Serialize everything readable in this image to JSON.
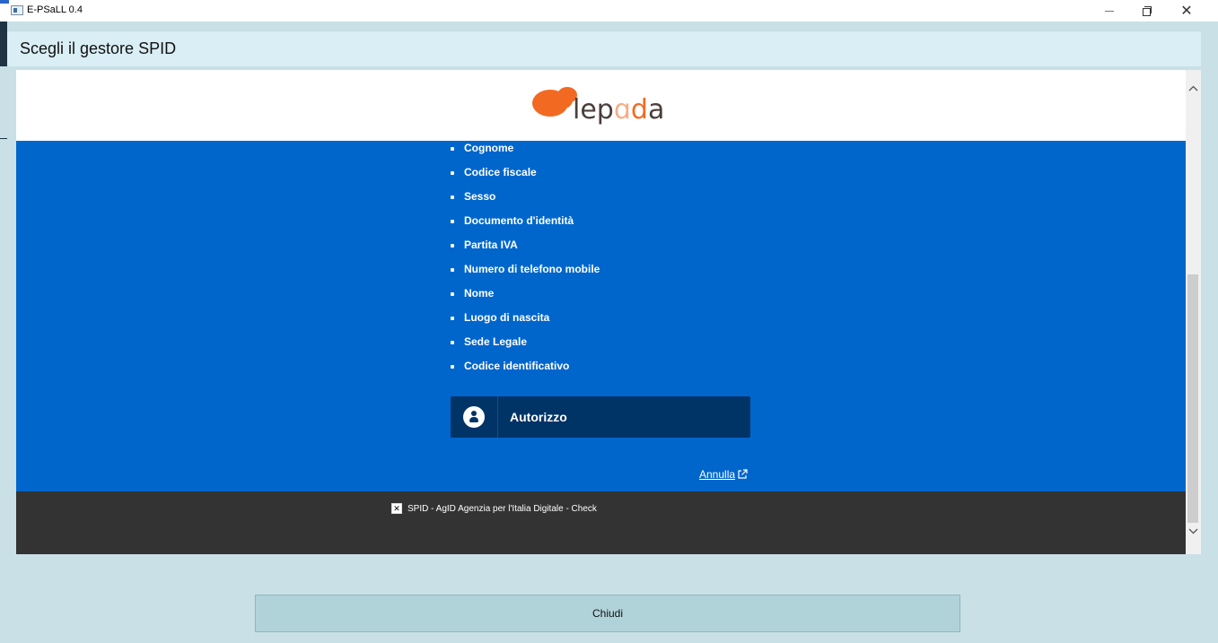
{
  "window": {
    "title": "E-PSaLL 0.4",
    "close_glyph": "✕"
  },
  "dialog": {
    "header": "Scegli il gestore SPID",
    "close_button_label": "Chiudi"
  },
  "browser": {
    "brand": {
      "logo_text": "lepida",
      "logo_colors": [
        "#f26a21",
        "#4a3e3b"
      ]
    },
    "attributes": [
      "Cognome",
      "Codice fiscale",
      "Sesso",
      "Documento d'identità",
      "Partita IVA",
      "Numero di telefono mobile",
      "Nome",
      "Luogo di nascita",
      "Sede Legale",
      "Codice identificativo"
    ],
    "authorize_button": {
      "label": "Autorizzo",
      "icon": "user-icon"
    },
    "cancel_link": {
      "label": "Annulla",
      "icon": "external-link-icon"
    },
    "footer": {
      "checkbox_text": "SPID - AgID Agenzia per l'Italia Digitale - Check"
    }
  },
  "colors": {
    "page_blue": "#0066cc",
    "button_navy": "#003366",
    "footer_dark": "#333333",
    "header_light": "#d9eef5"
  }
}
